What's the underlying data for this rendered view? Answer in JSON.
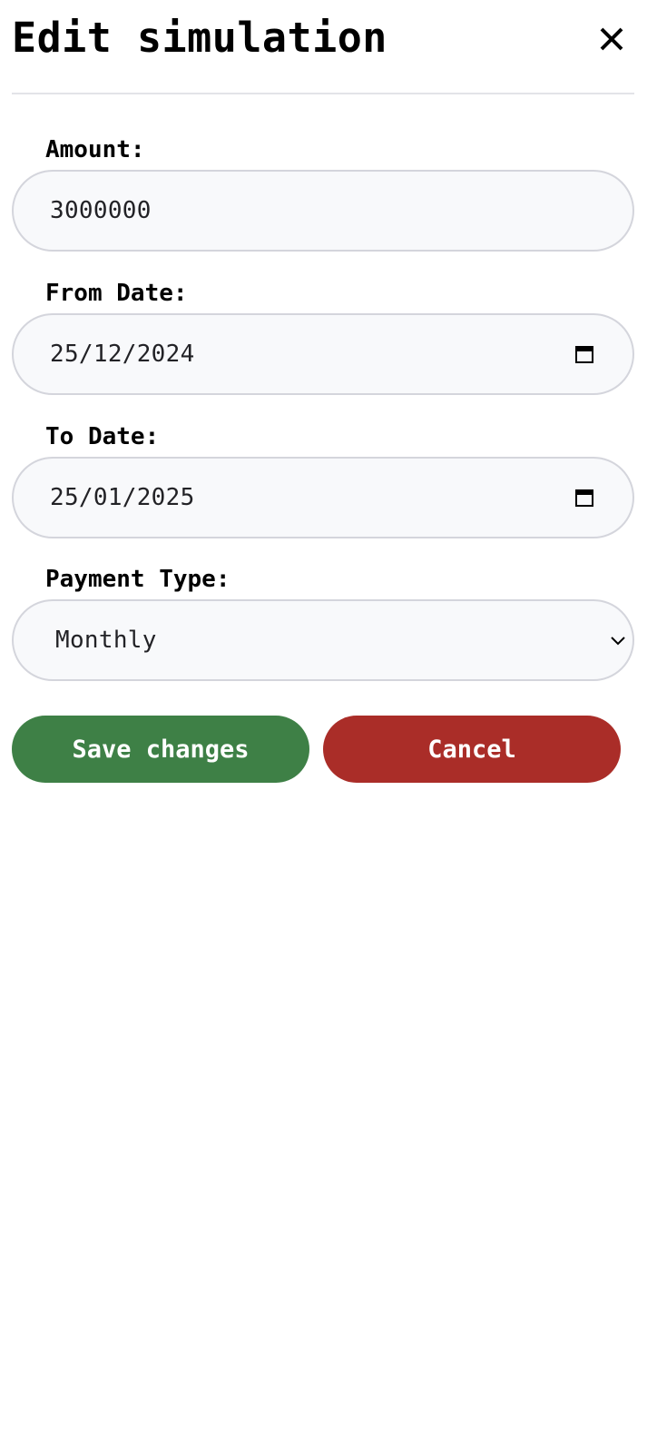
{
  "dialog": {
    "title": "Edit simulation"
  },
  "form": {
    "amount": {
      "label": "Amount:",
      "value": "3000000"
    },
    "from_date": {
      "label": "From Date:",
      "value": "25/12/2024"
    },
    "to_date": {
      "label": "To Date:",
      "value": "25/01/2025"
    },
    "payment_type": {
      "label": "Payment Type:",
      "selected": "Monthly"
    }
  },
  "actions": {
    "save_label": "Save changes",
    "cancel_label": "Cancel"
  },
  "colors": {
    "save": "#3e8046",
    "cancel": "#aa2d28",
    "field_bg": "#f8f9fb",
    "field_border": "#d4d5dc"
  },
  "icons": {
    "close": "close-icon",
    "calendar": "calendar-icon",
    "dropdown": "chevron-down-icon"
  }
}
